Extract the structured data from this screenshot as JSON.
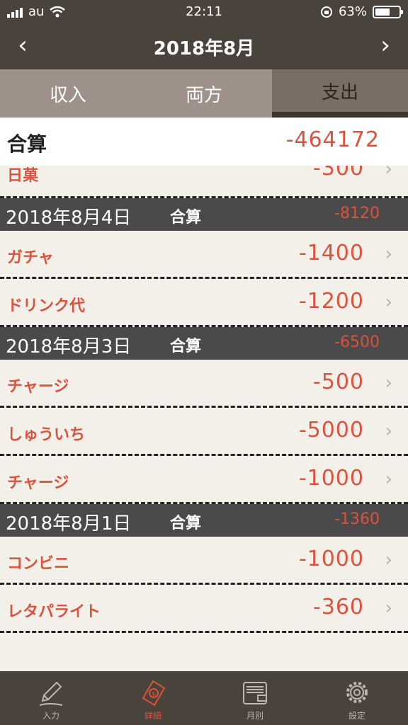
{
  "status": {
    "carrier": "au",
    "time": "22:11",
    "battery_percent": "63%",
    "battery_level": 0.63
  },
  "nav": {
    "title": "2018年8月",
    "prev_icon": "chevron-left-icon",
    "next_icon": "chevron-right-icon"
  },
  "segments": [
    {
      "label": "収入",
      "active": false
    },
    {
      "label": "両方",
      "active": false
    },
    {
      "label": "支出",
      "active": true
    }
  ],
  "total": {
    "label": "合算",
    "value": "-464172"
  },
  "partial_item": {
    "name": "日菓",
    "amount": "-300"
  },
  "groups": [
    {
      "date": "2018年8月4日",
      "label": "合算",
      "total": "-8120",
      "items": [
        {
          "name": "ガチャ",
          "amount": "-1400"
        },
        {
          "name": "ドリンク代",
          "amount": "-1200"
        }
      ]
    },
    {
      "date": "2018年8月3日",
      "label": "合算",
      "total": "-6500",
      "items": [
        {
          "name": "チャージ",
          "amount": "-500"
        },
        {
          "name": "しゅういち",
          "amount": "-5000"
        },
        {
          "name": "チャージ",
          "amount": "-1000"
        }
      ]
    },
    {
      "date": "2018年8月1日",
      "label": "合算",
      "total": "-1360",
      "items": [
        {
          "name": "コンビニ",
          "amount": "-1000"
        },
        {
          "name": "レタパライト",
          "amount": "-360"
        }
      ]
    }
  ],
  "chevron_glyph": "›",
  "tabs": [
    {
      "label": "入力",
      "icon": "pencil-icon",
      "active": false
    },
    {
      "label": "詳細",
      "icon": "money-note-icon",
      "active": true
    },
    {
      "label": "月別",
      "icon": "wallet-icon",
      "active": false
    },
    {
      "label": "設定",
      "icon": "gear-icon",
      "active": false
    }
  ],
  "colors": {
    "accent": "#d9533e",
    "bar": "#4a433c",
    "header": "#4a4a4a",
    "background": "#f3f0e9"
  }
}
